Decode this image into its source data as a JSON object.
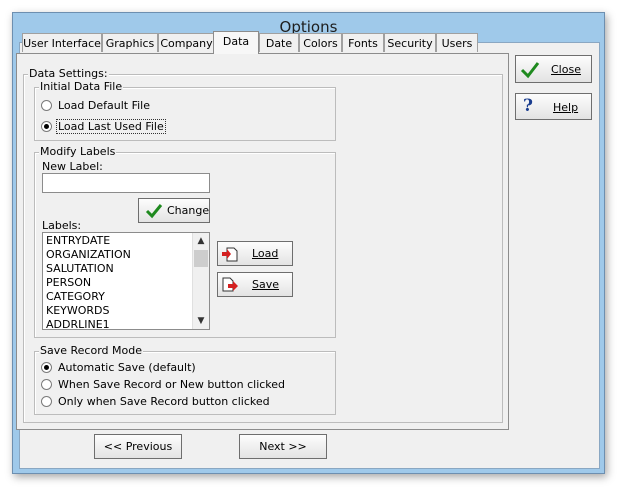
{
  "window": {
    "title": "Options"
  },
  "tabs": [
    {
      "label": "User Interface"
    },
    {
      "label": "Graphics"
    },
    {
      "label": "Company"
    },
    {
      "label": "Data",
      "active": true
    },
    {
      "label": "Date"
    },
    {
      "label": "Colors"
    },
    {
      "label": "Fonts"
    },
    {
      "label": "Security"
    },
    {
      "label": "Users"
    }
  ],
  "data_settings": {
    "legend": "Data Settings:",
    "initial_file": {
      "legend": "Initial Data File",
      "options": [
        {
          "label": "Load Default File",
          "selected": false
        },
        {
          "label": "Load Last Used File",
          "selected": true
        }
      ]
    },
    "modify_labels": {
      "legend": "Modify Labels",
      "new_label_caption": "New Label:",
      "new_label_value": "",
      "change_button": "Change",
      "labels_caption": "Labels:",
      "labels": [
        "ENTRYDATE",
        "ORGANIZATION",
        "SALUTATION",
        "PERSON",
        "CATEGORY",
        "KEYWORDS",
        "ADDRLINE1"
      ],
      "load_button": "Load",
      "save_button": "Save"
    },
    "save_mode": {
      "legend": "Save Record Mode",
      "options": [
        {
          "label": "Automatic Save (default)",
          "selected": true
        },
        {
          "label": "When Save Record or New button clicked",
          "selected": false
        },
        {
          "label": "Only when Save Record button clicked",
          "selected": false
        }
      ]
    }
  },
  "side_buttons": {
    "close": "Close",
    "help": "Help"
  },
  "nav": {
    "previous": "<< Previous",
    "next": "Next >>"
  },
  "colors": {
    "frame": "#9fc9ea",
    "checkmark": "#1f8a1f",
    "help": "#1a3d8f",
    "arrow": "#d42020"
  }
}
